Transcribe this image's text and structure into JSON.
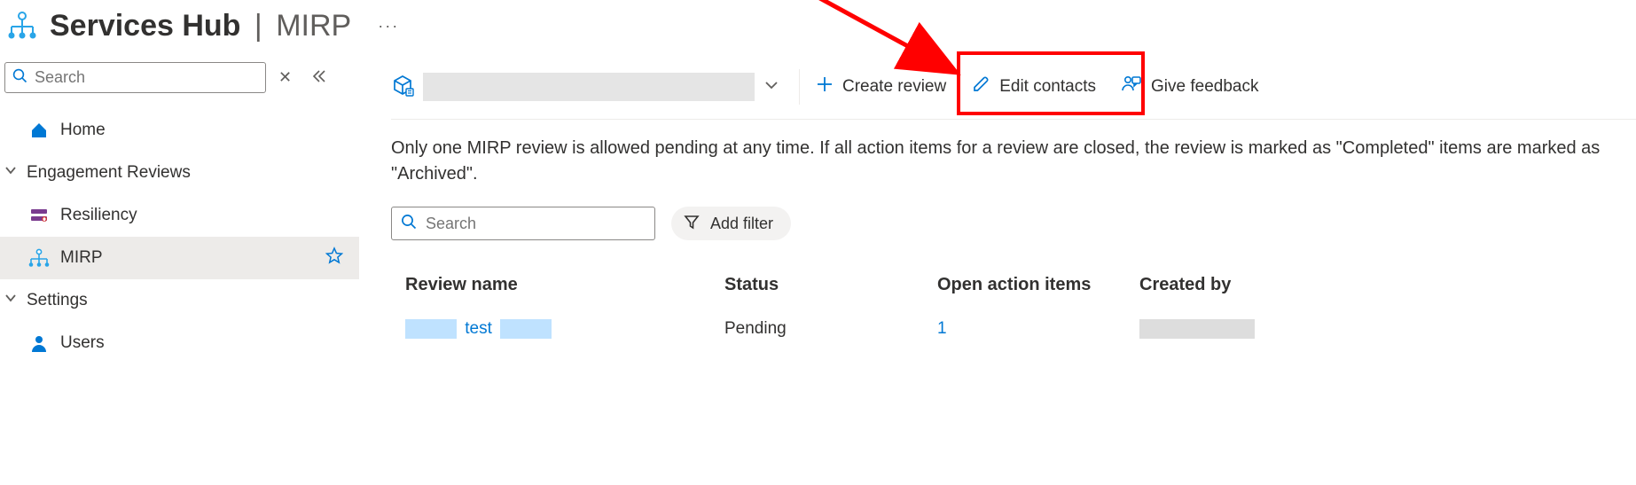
{
  "header": {
    "title_bold": "Services Hub",
    "title_sep": "|",
    "title_sub": "MIRP",
    "more": "···"
  },
  "sidebar": {
    "search_placeholder": "Search",
    "items": [
      {
        "label": "Home",
        "key": "home"
      },
      {
        "label": "Engagement Reviews",
        "key": "engagement-reviews",
        "expandable": true
      },
      {
        "label": "Resiliency",
        "key": "resiliency",
        "indent": true
      },
      {
        "label": "MIRP",
        "key": "mirp",
        "indent": true,
        "active": true,
        "starred": true
      },
      {
        "label": "Settings",
        "key": "settings",
        "expandable": true
      },
      {
        "label": "Users",
        "key": "users",
        "indent": true
      }
    ]
  },
  "toolbar": {
    "create_review": "Create review",
    "edit_contacts": "Edit contacts",
    "give_feedback": "Give feedback"
  },
  "description": "Only one MIRP review is allowed pending at any time. If all action items for a review are closed, the review is marked as \"Completed\" items are marked as \"Archived\".",
  "table": {
    "search_placeholder": "Search",
    "add_filter_label": "Add filter",
    "columns": {
      "name": "Review name",
      "status": "Status",
      "open": "Open action items",
      "created": "Created by"
    },
    "rows": [
      {
        "name_text": "test",
        "status": "Pending",
        "open": "1",
        "created_redacted": true
      }
    ]
  }
}
